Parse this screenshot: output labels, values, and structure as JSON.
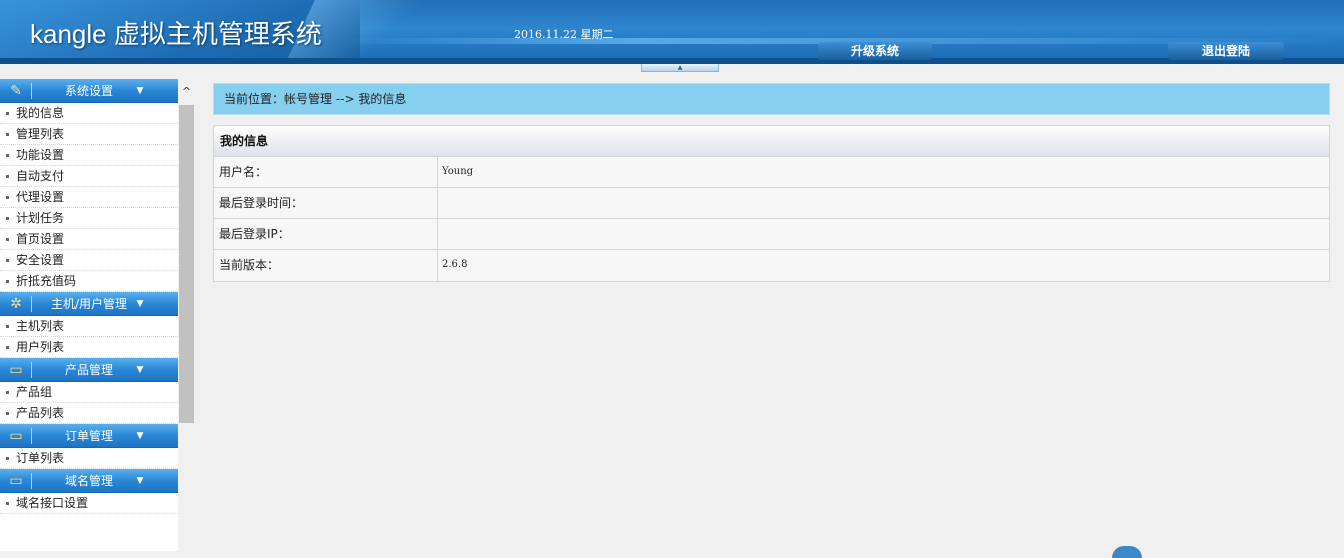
{
  "header": {
    "app_title": "kangle 虚拟主机管理系统",
    "date": "2016.11.22 星期二",
    "nav": {
      "upgrade_label": "升级系统",
      "logout_label": "退出登陆"
    },
    "collapse_icon": "up-arrow-icon",
    "collapse_glyph": "▲"
  },
  "sidebar": {
    "groups": [
      {
        "title": "系统设置",
        "icon": "folder-icon",
        "icon_glyph": "✎",
        "arrow": "▼",
        "items": [
          "我的信息",
          "管理列表",
          "功能设置",
          "自动支付",
          "代理设置",
          "计划任务",
          "首页设置",
          "安全设置",
          "折抵充值码"
        ]
      },
      {
        "title": "主机/用户管理",
        "icon": "users-icon",
        "icon_glyph": "✲",
        "arrow": "▼",
        "items": [
          "主机列表",
          "用户列表"
        ]
      },
      {
        "title": "产品管理",
        "icon": "monitor-icon",
        "icon_glyph": "▭",
        "arrow": "▼",
        "items": [
          "产品组",
          "产品列表"
        ]
      },
      {
        "title": "订单管理",
        "icon": "monitor-icon",
        "icon_glyph": "▭",
        "arrow": "▼",
        "items": [
          "订单列表"
        ]
      },
      {
        "title": "域名管理",
        "icon": "monitor-icon",
        "icon_glyph": "▭",
        "arrow": "▼",
        "items": [
          "域名接口设置"
        ]
      }
    ],
    "scrollbar_up_glyph": "^"
  },
  "main": {
    "breadcrumb": "当前位置：帐号管理 --> 我的信息",
    "panel_title": "我的信息",
    "rows": [
      {
        "label": "用户名：",
        "value": "Young"
      },
      {
        "label": "最后登录时间：",
        "value": ""
      },
      {
        "label": "最后登录IP：",
        "value": ""
      },
      {
        "label": "当前版本：",
        "value": "2.6.8"
      }
    ]
  },
  "colors": {
    "header_blue": "#1f6fb6",
    "breadcrumb_bg": "#87cfee",
    "menu_header_blue": "#2b87d6"
  }
}
